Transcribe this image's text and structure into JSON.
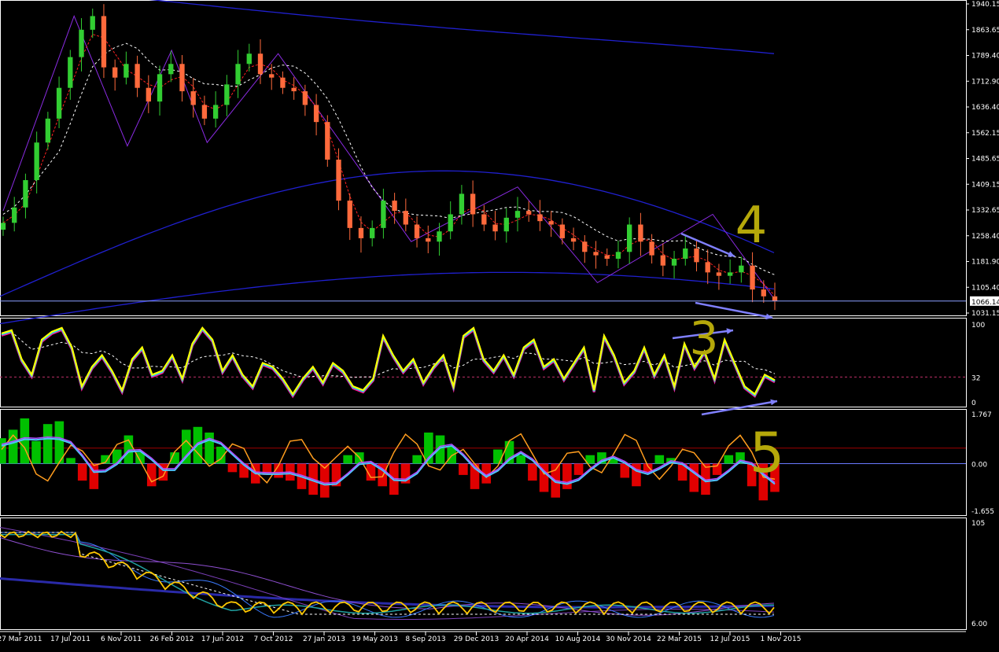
{
  "colors": {
    "background": "#000000",
    "frame": "#ffffff",
    "bull_candle": "#32cd32",
    "bear_candle": "#ff6a3c",
    "envelope": "#2020d0",
    "zigzag": "#8a2be2",
    "ma_fast": "#ff2020",
    "ma_slow": "#ffffff",
    "rsi_line": "#ffff00",
    "rsi_glow_a": "#ff1493",
    "rsi_glow_b": "#00e5ff",
    "fisher_up": "#00c000",
    "fisher_down": "#e00000",
    "fisher_signal": "#ff9d1e",
    "fisher_line": "#b44cff",
    "annotation_arrow": "#8080ff",
    "annotation_digit": "#b5a80a"
  },
  "chart_data": [
    {
      "type": "candlestick",
      "panel": "price",
      "title": "",
      "price_axis_labels": [
        "1940.15",
        "1863.65",
        "1789.40",
        "1712.90",
        "1636.40",
        "1562.15",
        "1485.65",
        "1409.15",
        "1332.65",
        "1258.40",
        "1181.90",
        "1105.40",
        "1031.15"
      ],
      "current_price_label": "1066.14",
      "current_price": 1066.14,
      "ylim": [
        1031.15,
        1940.15
      ],
      "series": [
        {
          "values": [
            1295,
            1340,
            1420,
            1530,
            1600,
            1690,
            1780,
            1860,
            1900,
            1750,
            1720,
            1760,
            1690,
            1650,
            1730,
            1760,
            1680,
            1640,
            1600,
            1640,
            1700,
            1760,
            1790,
            1730,
            1720,
            1690,
            1680,
            1640,
            1590,
            1480,
            1360,
            1280,
            1250,
            1280,
            1360,
            1330,
            1290,
            1250,
            1240,
            1270,
            1320,
            1380,
            1320,
            1290,
            1270,
            1310,
            1330,
            1320,
            1300,
            1290,
            1250,
            1240,
            1210,
            1200,
            1190,
            1210,
            1290,
            1240,
            1200,
            1170,
            1190,
            1220,
            1180,
            1150,
            1140,
            1150,
            1170,
            1100,
            1080,
            1066
          ]
        }
      ],
      "annotations": [
        "4"
      ]
    },
    {
      "type": "line",
      "panel": "rsi",
      "title": "",
      "axis_labels": [
        "100",
        "32",
        "0"
      ],
      "ylim": [
        0,
        100
      ],
      "level": 32,
      "series": [
        {
          "values": [
            88,
            92,
            55,
            35,
            80,
            90,
            95,
            70,
            20,
            45,
            60,
            40,
            15,
            55,
            70,
            35,
            40,
            60,
            30,
            75,
            95,
            80,
            40,
            60,
            35,
            20,
            50,
            45,
            30,
            10,
            30,
            45,
            25,
            50,
            40,
            20,
            15,
            30,
            85,
            60,
            40,
            55,
            25,
            45,
            60,
            20,
            85,
            95,
            55,
            40,
            60,
            35,
            70,
            80,
            45,
            55,
            30,
            50,
            70,
            15,
            85,
            60,
            25,
            40,
            70,
            35,
            60,
            20,
            75,
            45,
            65,
            30,
            80,
            50,
            20,
            10,
            35,
            28
          ]
        }
      ],
      "annotations": [
        "3"
      ]
    },
    {
      "type": "bar",
      "panel": "fisher",
      "title": "",
      "axis_labels": [
        "1.767",
        "0.00",
        "-1.655"
      ],
      "ylim": [
        -1.655,
        1.767
      ],
      "series": [
        {
          "name": "histogram",
          "values": [
            0.9,
            1.2,
            1.6,
            0.8,
            1.4,
            1.5,
            0.2,
            -0.6,
            -0.9,
            0.3,
            0.5,
            1.0,
            0.4,
            -0.8,
            -0.6,
            0.4,
            1.2,
            1.3,
            1.1,
            0.6,
            -0.3,
            -0.5,
            -0.7,
            -0.4,
            -0.5,
            -0.6,
            -0.9,
            -1.1,
            -1.2,
            -0.8,
            0.3,
            0.4,
            -0.6,
            -0.8,
            -1.1,
            -0.7,
            0.3,
            1.1,
            1.0,
            0.6,
            -0.4,
            -0.9,
            -0.7,
            0.5,
            0.8,
            0.3,
            -0.6,
            -1.0,
            -1.2,
            -0.9,
            -0.4,
            0.3,
            0.4,
            0.2,
            -0.5,
            -0.8,
            -0.3,
            0.3,
            0.2,
            -0.6,
            -1.0,
            -1.1,
            -0.4,
            0.3,
            0.4,
            -0.8,
            -1.3,
            -1.0
          ]
        }
      ],
      "annotations": [
        "5"
      ]
    },
    {
      "type": "line",
      "panel": "oscillator",
      "title": "",
      "axis_labels": [
        "105",
        "6.00"
      ],
      "x_tick_labels": [
        "27 Mar 2011",
        "17 Jul 2011",
        "6 Nov 2011",
        "26 Feb 2012",
        "17 Jun 2012",
        "7 Oct 2012",
        "27 Jan 2013",
        "19 May 2013",
        "8 Sep 2013",
        "29 Dec 2013",
        "20 Apr 2014",
        "10 Aug 2014",
        "30 Nov 2014",
        "22 Mar 2015",
        "12 Jul 2015",
        "1 Nov 2015"
      ]
    }
  ]
}
